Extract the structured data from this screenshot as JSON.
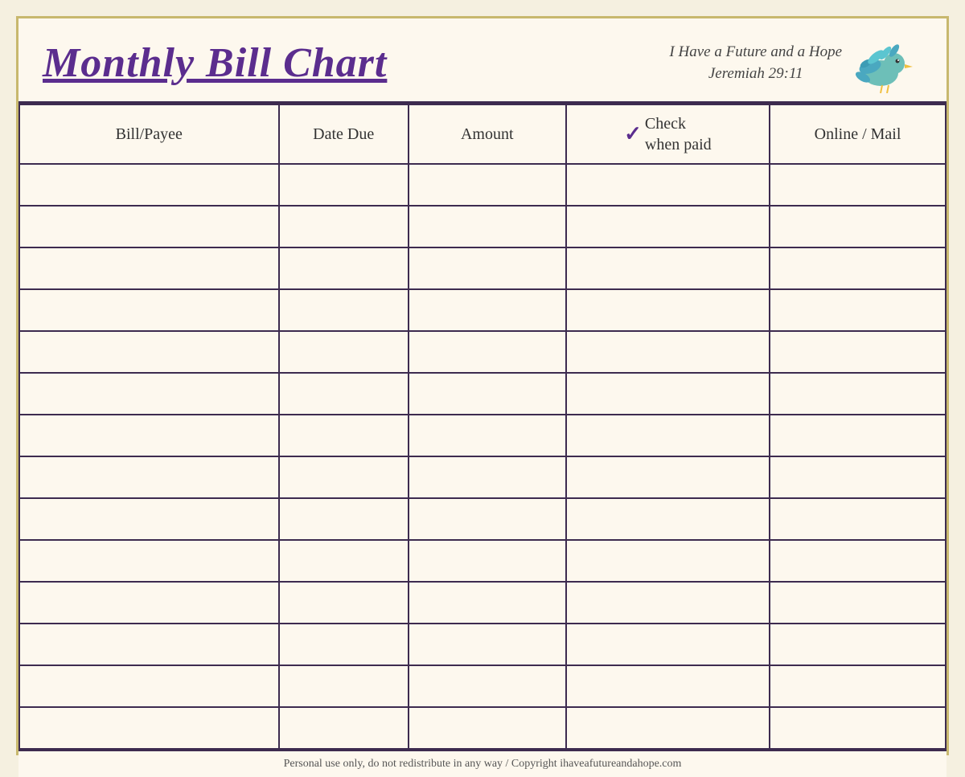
{
  "header": {
    "title": "Monthly Bill Chart",
    "subtitle_line1": "I Have a Future and a Hope",
    "subtitle_line2": "Jeremiah 29:11"
  },
  "columns": [
    {
      "id": "bill",
      "label": "Bill/Payee"
    },
    {
      "id": "date",
      "label": "Date Due"
    },
    {
      "id": "amount",
      "label": "Amount"
    },
    {
      "id": "check",
      "label_line1": "Check",
      "label_line2": "when paid",
      "has_checkmark": true
    },
    {
      "id": "online",
      "label": "Online / Mail"
    }
  ],
  "row_count": 14,
  "footer": {
    "text": "Personal use only, do not redistribute in any way / Copyright ihaveafutureandahope.com"
  },
  "colors": {
    "title": "#5b2d8e",
    "border": "#3d2b4f",
    "checkmark": "#5b2d8e",
    "background": "#fdf8ee",
    "outer_border": "#c8b86e"
  }
}
